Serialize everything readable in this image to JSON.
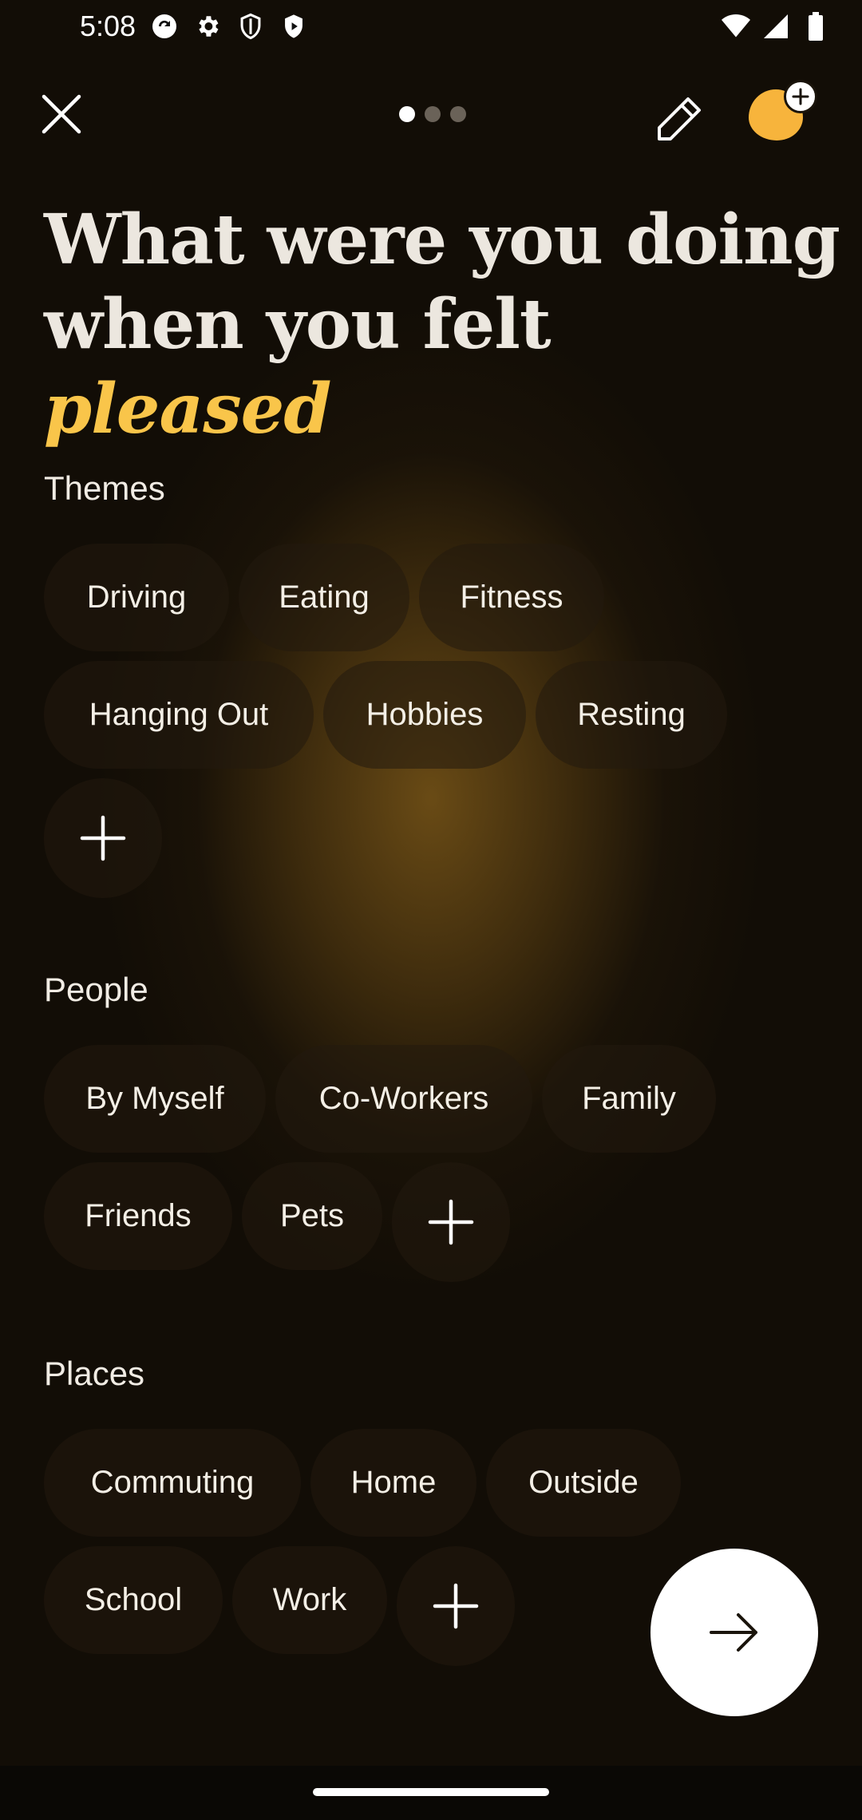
{
  "status_bar": {
    "time": "5:08",
    "icons": [
      "sync-icon",
      "settings-icon",
      "shield-icon",
      "play-shield-icon"
    ],
    "right_icons": [
      "wifi-icon",
      "signal-icon",
      "battery-icon"
    ]
  },
  "header": {
    "pager": {
      "total": 3,
      "active": 1
    },
    "mood_color": "#f7b43c"
  },
  "question": {
    "prefix": "What were you doing when you felt",
    "emotion": "pleased"
  },
  "sections": {
    "themes": {
      "label": "Themes",
      "chips": [
        "Driving",
        "Eating",
        "Fitness",
        "Hanging Out",
        "Hobbies",
        "Resting"
      ]
    },
    "people": {
      "label": "People",
      "chips": [
        "By Myself",
        "Co-Workers",
        "Family",
        "Friends",
        "Pets"
      ]
    },
    "places": {
      "label": "Places",
      "chips": [
        "Commuting",
        "Home",
        "Outside",
        "School",
        "Work"
      ]
    }
  },
  "colors": {
    "accent": "#f9c54a",
    "background": "#120d06",
    "chip": "#2a2013"
  }
}
